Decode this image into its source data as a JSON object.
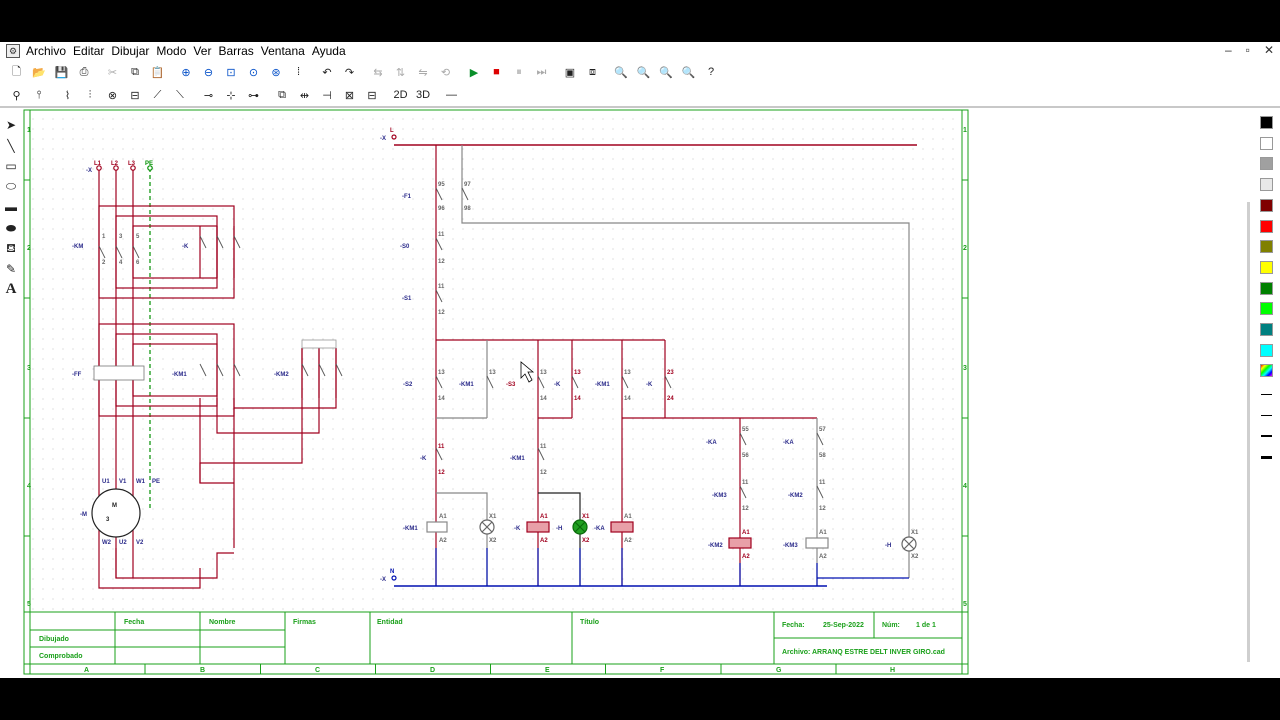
{
  "app": {
    "menus": [
      "Archivo",
      "Editar",
      "Dibujar",
      "Modo",
      "Ver",
      "Barras",
      "Ventana",
      "Ayuda"
    ],
    "window_controls": [
      "–",
      "▫",
      "✕"
    ]
  },
  "toolbar1": [
    "new-icon",
    "open-icon",
    "save-icon",
    "print-icon",
    "cut-icon",
    "copy-icon",
    "paste-icon",
    "zoom-in-icon",
    "zoom-out-icon",
    "zoom-window-icon",
    "zoom-fit-icon",
    "zoom-all-icon",
    "grid-icon",
    "undo-icon",
    "redo-icon",
    "mirror-h-icon",
    "mirror-v-icon",
    "flip-icon",
    "rotate-icon",
    "run-icon",
    "stop-icon",
    "pause-icon",
    "step-icon",
    "screen-icon",
    "screen2-icon",
    "zoom-plus-icon",
    "zoom-minus-icon",
    "zoom-page-icon",
    "zoom-prev-icon",
    "help-icon"
  ],
  "toolbar2": [
    "probe-icon",
    "pin-icon",
    "wire-icon",
    "multi-wire-icon",
    "coil-icon",
    "battery-icon",
    "switch-no-icon",
    "switch-nc-icon",
    "node-icon",
    "cross-icon",
    "junction-icon",
    "tool-a-icon",
    "tool-b-icon",
    "tool-c-icon",
    "tool-d-icon",
    "tool-e-icon",
    "two-d-icon",
    "three-d-icon",
    "line-tool-icon"
  ],
  "left_tools": [
    "select-arrow-icon",
    "line-icon",
    "rectangle-icon",
    "ellipse-icon",
    "filled-rect-icon",
    "filled-ellipse-icon",
    "fill-bucket-icon",
    "eyedropper-icon",
    "text-icon"
  ],
  "palette": {
    "colors": [
      "#000000",
      "#ffffff",
      "#a0a0a0",
      "#e8e8e8",
      "#800000",
      "#ff0000",
      "#808000",
      "#ffff00",
      "#008000",
      "#00ff00",
      "#008080",
      "#00ffff",
      "#ff00ff"
    ],
    "line_widths": [
      1,
      1,
      2,
      3
    ]
  },
  "drawing": {
    "rows": [
      "1",
      "2",
      "3",
      "4",
      "5"
    ],
    "cols": [
      "A",
      "B",
      "C",
      "D",
      "E",
      "F",
      "G",
      "H"
    ],
    "power_labels": {
      "l1": "L1",
      "l2": "L2",
      "l3": "L3",
      "pe": "PE",
      "x_top": "-X",
      "km_main": "-KM",
      "k": "-K",
      "f_thermal": "-FF",
      "km1": "-KM1",
      "km2": "-KM2",
      "motor": "-M",
      "motor_letter": "M",
      "motor_phase": "3",
      "u1": "U1",
      "v1": "V1",
      "w1": "W1",
      "w2": "W2",
      "u2": "U2",
      "v2": "V2",
      "pe_motor": "PE",
      "t1": "1",
      "t3": "3",
      "t5": "5",
      "t2": "2",
      "t4": "4",
      "t6": "6"
    },
    "control_labels": {
      "x_l": "-X",
      "l": "L",
      "f1": "-F1",
      "n95": "95",
      "n96": "96",
      "n97": "97",
      "n98": "98",
      "s0": "-S0",
      "s1": "-S1",
      "n11": "11",
      "n12": "12",
      "s2": "-S2",
      "s3": "-S3",
      "km1": "-KM1",
      "k": "-K",
      "n13": "13",
      "n14": "14",
      "n23": "23",
      "n24": "24",
      "ka": "-KA",
      "n55": "55",
      "n56": "56",
      "n57": "57",
      "n58": "58",
      "km3": "-KM3",
      "km2": "-KM2",
      "a1": "A1",
      "a2": "A2",
      "x1": "X1",
      "x2": "X2",
      "h": "-H",
      "x_n": "-X",
      "n": "N"
    },
    "title_block": {
      "fecha_header": "Fecha",
      "nombre_header": "Nombre",
      "firmas": "Firmas",
      "entidad": "Entidad",
      "titulo": "Título",
      "dibujado": "Dibujado",
      "comprobado": "Comprobado",
      "fecha_label": "Fecha:",
      "fecha_value": "25-Sep-2022",
      "num_label": "Núm:",
      "num_value": "1 de 1",
      "archivo_label": "Archivo:",
      "archivo_value": "ARRANQ ESTRE DELT INVER GIRO.cad"
    }
  },
  "colors": {
    "frame": "#1aa01a",
    "power": "#a0001e",
    "neutral": "#0010b0",
    "wire_gray": "#888888",
    "pe": "#009000",
    "label": "#2a2a8a"
  }
}
